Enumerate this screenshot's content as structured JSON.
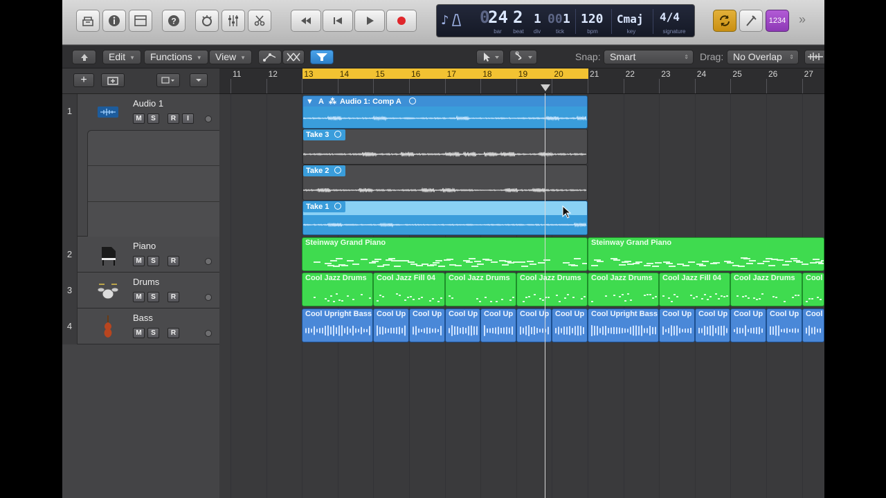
{
  "control_bar": {
    "buttons": [
      "library-icon",
      "inspector-icon",
      "toolbar-icon",
      "quick-help-icon",
      "smart-controls-icon",
      "mixer-icon",
      "editors-icon"
    ],
    "transport": [
      "rewind-icon",
      "go-to-beginning-icon",
      "play-icon",
      "record-icon"
    ],
    "lcd": {
      "bar": "24",
      "beat": "2",
      "div": "1",
      "tick": "1",
      "tick_prefix": "00",
      "bar_prefix": "0",
      "bpm": "120",
      "key": "Cmaj",
      "signature": "4/4",
      "captions": {
        "bar": "bar",
        "beat": "beat",
        "div": "div",
        "tick": "tick",
        "bpm": "bpm",
        "key": "key",
        "signature": "signature"
      }
    },
    "right": {
      "cycle": "cycle-icon",
      "tuner": "tuner-icon",
      "count_in": "1234",
      "more": "»"
    }
  },
  "toolbar": {
    "edit": "Edit",
    "functions": "Functions",
    "view": "View",
    "snap_label": "Snap:",
    "snap_value": "Smart",
    "drag_label": "Drag:",
    "drag_value": "No Overlap"
  },
  "ruler": {
    "bars": [
      "11",
      "12",
      "13",
      "14",
      "15",
      "16",
      "17",
      "18",
      "19",
      "20",
      "21",
      "22",
      "23",
      "24",
      "25",
      "26",
      "27"
    ]
  },
  "tracks": [
    {
      "num": "1",
      "name": "Audio 1",
      "buttons": [
        "M",
        "S",
        "R",
        "I"
      ]
    },
    {
      "num": "2",
      "name": "Piano",
      "buttons": [
        "M",
        "S",
        "R"
      ]
    },
    {
      "num": "3",
      "name": "Drums",
      "buttons": [
        "M",
        "S",
        "R"
      ]
    },
    {
      "num": "4",
      "name": "Bass",
      "buttons": [
        "M",
        "S",
        "R"
      ]
    }
  ],
  "regions": {
    "comp": "Audio 1: Comp A",
    "comp_flags": "A",
    "takes": [
      "Take 3",
      "Take 2",
      "Take 1"
    ],
    "piano": [
      "Steinway Grand Piano",
      "Steinway Grand Piano"
    ],
    "drums": [
      "Cool Jazz Drums",
      "Cool Jazz Fill 04",
      "Cool Jazz Drums",
      "Cool Jazz Drums",
      "Cool Jazz Drums",
      "Cool Jazz Fill 04",
      "Cool Jazz Drums",
      "Cool"
    ],
    "bass": [
      "Cool Upright Bass",
      "Cool Up",
      "Cool Up",
      "Cool Up",
      "Cool Up",
      "Cool Up",
      "Cool Up",
      "Cool Upright Bass",
      "Cool Up",
      "Cool Up",
      "Cool Up",
      "Cool Up",
      "Cool"
    ]
  },
  "colors": {
    "cycle": "#f2c232",
    "audio": "#3a9ddb",
    "midi": "#3fdb4f",
    "bass": "#4a88d8"
  }
}
